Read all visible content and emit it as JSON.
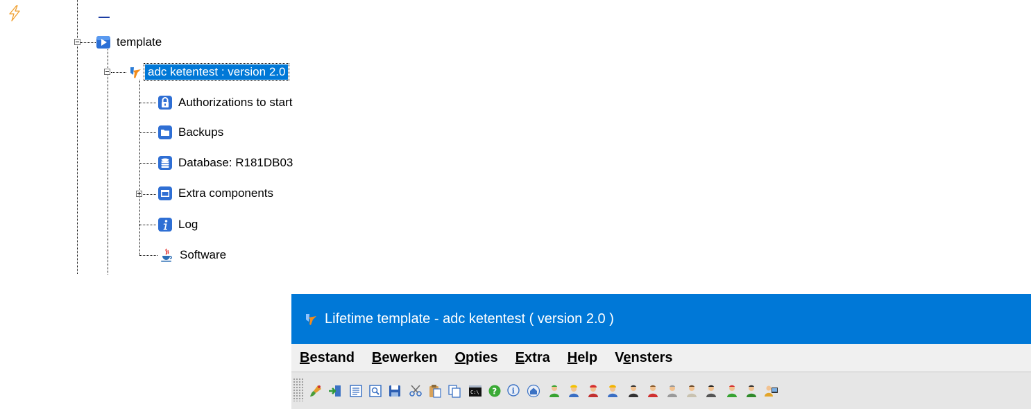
{
  "tree": {
    "root": {
      "label": "template",
      "icon": "play-folder-icon",
      "expanded": true
    },
    "app": {
      "label": "adc ketentest : version 2.0",
      "icon": "lifetime-logo-icon",
      "selected": true,
      "expanded": true
    },
    "children": [
      {
        "label": "Authorizations to start",
        "icon": "lock-icon",
        "expander": null
      },
      {
        "label": "Backups",
        "icon": "folder-icon",
        "expander": null
      },
      {
        "label": "Database: R181DB03",
        "icon": "database-icon",
        "expander": null
      },
      {
        "label": "Extra components",
        "icon": "window-icon",
        "expander": "plus"
      },
      {
        "label": "Log",
        "icon": "info-icon",
        "expander": null
      },
      {
        "label": "Software",
        "icon": "java-icon",
        "expander": null
      }
    ]
  },
  "window": {
    "title": "Lifetime template - adc ketentest ( version  2.0 )",
    "menu": [
      {
        "access": "B",
        "rest": "estand"
      },
      {
        "access": "B",
        "rest": "ewerken"
      },
      {
        "access": "O",
        "rest": "pties"
      },
      {
        "access": "E",
        "rest": "xtra"
      },
      {
        "access": "H",
        "rest": "elp"
      },
      {
        "pre": "V",
        "access": "e",
        "rest": "nsters"
      }
    ],
    "toolbar": [
      "paint-brush-icon",
      "exit-door-icon",
      "list-icon",
      "preview-icon",
      "save-icon",
      "cut-icon",
      "paste-icon",
      "copy-icon",
      "console-icon",
      "help-icon",
      "info-icon",
      "home-icon",
      "user-green-icon",
      "user-worker-icon",
      "user-red-hat-icon",
      "user-yellow-hat-icon",
      "user-dark-icon",
      "user-red-icon",
      "user-grey-icon",
      "user-beige-icon",
      "user-black-icon",
      "user-green-red-icon",
      "user-green-dark-icon",
      "user-computer-icon"
    ]
  },
  "colors": {
    "selection": "#0078d7",
    "titlebar": "#0078d7",
    "menubar": "#f0f0f0",
    "toolbar": "#e6e6e6"
  }
}
